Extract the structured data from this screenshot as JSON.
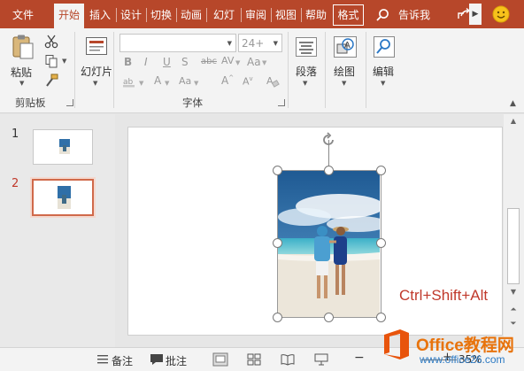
{
  "tabs": [
    {
      "label": "文件",
      "active": false
    },
    {
      "label": "开始",
      "active": true
    },
    {
      "label": "插入",
      "active": false
    },
    {
      "label": "设计",
      "active": false
    },
    {
      "label": "切换",
      "active": false
    },
    {
      "label": "动画",
      "active": false
    },
    {
      "label": "幻灯",
      "active": false
    },
    {
      "label": "审阅",
      "active": false
    },
    {
      "label": "视图",
      "active": false
    },
    {
      "label": "帮助",
      "active": false
    },
    {
      "label": "格式",
      "active": false
    }
  ],
  "tell_me": "告诉我",
  "ribbon": {
    "clipboard": {
      "paste_label": "粘贴",
      "group_label": "剪贴板"
    },
    "slides": {
      "new_slide_label": "幻灯片"
    },
    "font": {
      "font_name": "",
      "font_size": "24+",
      "group_label": "字体"
    },
    "paragraph": {
      "label": "段落"
    },
    "drawing": {
      "label": "绘图"
    },
    "editing": {
      "label": "编辑"
    }
  },
  "slides": [
    {
      "number": "1",
      "selected": false
    },
    {
      "number": "2",
      "selected": true
    }
  ],
  "slide_text": "Ctrl+Shift+Alt",
  "statusbar": {
    "notes_label": "备注",
    "comments_label": "批注",
    "zoom": "35%"
  },
  "watermark": {
    "brand": "Office教程网",
    "url": "www.office26.com"
  },
  "colors": {
    "accent": "#b7472a",
    "shortcut_text": "#c0392b",
    "selected_thumb_border": "#d0694a"
  }
}
